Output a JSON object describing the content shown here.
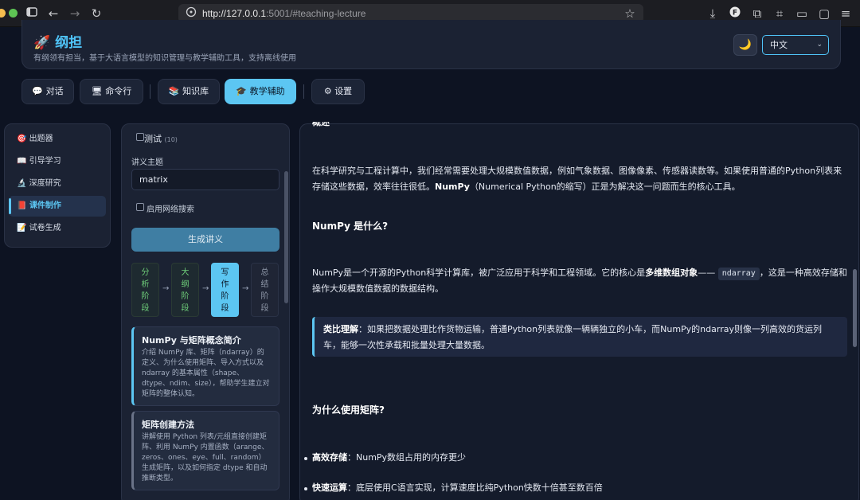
{
  "browser": {
    "url_host": "http://127.0.0.1",
    "url_rest": ":5001/#teaching-lecture"
  },
  "app": {
    "title": "纲担",
    "title_icon": "🚀",
    "subtitle": "有纲领有担当，基于大语言模型的知识管理与教学辅助工具，支持离线使用",
    "theme_icon": "🌙",
    "language": "中文"
  },
  "tabs": [
    {
      "icon": "💬",
      "label": "对话"
    },
    {
      "icon": "🖥",
      "label": "命令行"
    },
    {
      "icon": "📚",
      "label": "知识库"
    },
    {
      "icon": "🎓",
      "label": "教学辅助"
    },
    {
      "icon": "⚙",
      "label": "设置"
    }
  ],
  "sidebar": {
    "items": [
      {
        "icon": "🎯",
        "label": "出题器"
      },
      {
        "icon": "📖",
        "label": "引导学习"
      },
      {
        "icon": "🔬",
        "label": "深度研究"
      },
      {
        "icon": "📕",
        "label": "课件制作"
      },
      {
        "icon": "📝",
        "label": "试卷生成"
      }
    ]
  },
  "lecture_form": {
    "top_item": "测试",
    "top_item_count": "(10)",
    "topic_label": "讲义主题",
    "topic_value": "matrix",
    "web_search_label": "启用网络搜索",
    "generate_label": "生成讲义",
    "stages": [
      "分析阶段",
      "大纲阶段",
      "写作阶段",
      "总结阶段"
    ],
    "arrow": "→"
  },
  "lecture_sections": [
    {
      "title": "NumPy 与矩阵概念简介",
      "desc": "介绍 NumPy 库、矩阵（ndarray）的定义、为什么使用矩阵、导入方式以及 ndarray 的基本属性（shape、dtype、ndim、size），帮助学生建立对矩阵的整体认知。"
    },
    {
      "title": "矩阵创建方法",
      "desc": "讲解使用 Python 列表/元组直接创建矩阵、利用 NumPy 内置函数（arange、zeros、ones、eye、full、random）生成矩阵，以及如何指定 dtype 和自动推断类型。"
    }
  ],
  "content": {
    "top_heading": "概述",
    "intro_p1": "在科学研究与工程计算中，我们经常需要处理大规模数值数据，例如气象数据、图像像素、传感器读数等。如果使用普通的Python列表来",
    "intro_p2_pre": "存储这些数据，效率往往很低。",
    "intro_p2_bold": "NumPy",
    "intro_p2_post": "（Numerical Python的缩写）正是为解决这一问题而生的核心工具。",
    "h_what": "NumPy 是什么?",
    "what_p1_pre": "NumPy是一个开源的Python科学计算库，被广泛应用于科学和工程领域。它的核心是",
    "what_p1_bold": "多维数组对象",
    "what_p1_dash": "——",
    "what_p1_code": "ndarray",
    "what_p1_post": "，这是一种高效存储和",
    "what_p2": "操作大规模数值数据的数据结构。",
    "callout_bold": "类比理解",
    "callout_l1": "：如果把数据处理比作货物运输，普通Python列表就像一辆辆独立的小车，而NumPy的ndarray则像一列高效的货运列",
    "callout_l2": "车，能够一次性承载和批量处理大量数据。",
    "h_why": "为什么使用矩阵?",
    "bullets": [
      {
        "bold": "高效存储",
        "text": "：NumPy数组占用的内存更少"
      },
      {
        "bold": "快速运算",
        "text": "：底层使用C语言实现，计算速度比纯Python快数十倍甚至数百倍"
      }
    ]
  }
}
